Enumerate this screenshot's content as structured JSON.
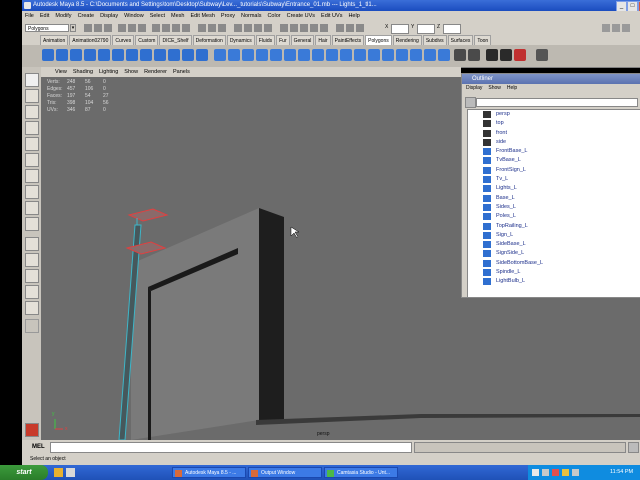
{
  "window": {
    "title": "Autodesk Maya 8.5 - C:\\Documents and Settings\\tom\\Desktop\\Subway\\Lev..._tutorials\\Subway\\Entrance_01.mb  ---  Lights_1_tl1..."
  },
  "menubar": {
    "items": [
      "File",
      "Edit",
      "Modify",
      "Create",
      "Display",
      "Window",
      "Select",
      "Mesh",
      "Edit Mesh",
      "Proxy",
      "Normals",
      "Color",
      "Create UVs",
      "Edit UVs",
      "Help"
    ]
  },
  "statusline": {
    "mode": "Polygons",
    "field_labels": [
      "X",
      "Y",
      "Z"
    ]
  },
  "shelf": {
    "tabs": [
      "Animation",
      "Animation02790",
      "Curves",
      "Custom",
      "DICE_Shelf",
      "Deformation",
      "Dynamics",
      "Fluids",
      "Fur",
      "General",
      "Hair",
      "PaintEffects",
      "Polygons",
      "Rendering",
      "Subdivs",
      "Surfaces",
      "Toon"
    ],
    "active_tab": "Polygons"
  },
  "panel": {
    "menu": [
      "View",
      "Shading",
      "Lighting",
      "Show",
      "Renderer",
      "Panels"
    ],
    "hud": [
      {
        "label": "Verts:",
        "a": "248",
        "b": "56",
        "c": "0"
      },
      {
        "label": "Edges:",
        "a": "457",
        "b": "106",
        "c": "0"
      },
      {
        "label": "Faces:",
        "a": "197",
        "b": "54",
        "c": "27"
      },
      {
        "label": "Tris:",
        "a": "398",
        "b": "104",
        "c": "56"
      },
      {
        "label": "UVs:",
        "a": "346",
        "b": "87",
        "c": "0"
      }
    ],
    "camera_label": "persp",
    "axis": {
      "y": "y",
      "x": "x"
    }
  },
  "outliner": {
    "title": "Outliner",
    "menu": [
      "Display",
      "Show",
      "Help"
    ],
    "items": [
      "persp",
      "top",
      "front",
      "side",
      "FrontBase_L",
      "TvBase_L",
      "FrontSign_L",
      "Tv_L",
      "Lights_L",
      "Base_L",
      "Sides_L",
      "Poles_L",
      "TopRailing_L",
      "Sign_L",
      "SideBase_L",
      "SignSide_L",
      "SideBottomBase_L",
      "Spindle_L",
      "LightBulb_L"
    ]
  },
  "cmdline": {
    "label": "MEL"
  },
  "helpline": {
    "text": "Select an object"
  },
  "taskbar": {
    "start": "start",
    "tasks": [
      "Autodesk Maya 8.5 - ...",
      "Output Window",
      "Camtasia Studio - Unt..."
    ],
    "time": "11:54 PM"
  },
  "colors": {
    "viewport": "#6b6b6b",
    "selection": "#3eb6c8",
    "titlebar": "#1b4cbf"
  }
}
